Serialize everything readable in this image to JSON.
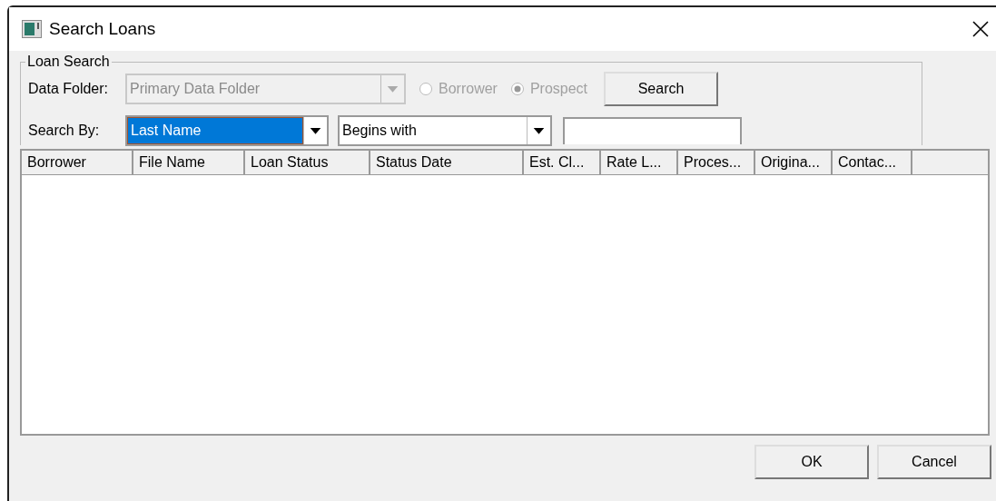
{
  "window": {
    "title": "Search Loans"
  },
  "loan_search": {
    "legend": "Loan Search",
    "data_folder": {
      "label": "Data Folder:",
      "value": "Primary Data Folder",
      "disabled": true
    },
    "radios": [
      {
        "label": "Borrower",
        "selected": false,
        "disabled": true
      },
      {
        "label": "Prospect",
        "selected": true,
        "disabled": true
      }
    ],
    "search_button": "Search",
    "search_by": {
      "label": "Search By:",
      "value": "Last Name",
      "focused": true
    },
    "operator": {
      "value": "Begins with"
    }
  },
  "table": {
    "columns": [
      "Borrower",
      "File Name",
      "Loan Status",
      "Status Date",
      "Est. Cl...",
      "Rate L...",
      "Proces...",
      "Origina...",
      "Contac..."
    ]
  },
  "buttons": [
    "OK",
    "Cancel"
  ]
}
